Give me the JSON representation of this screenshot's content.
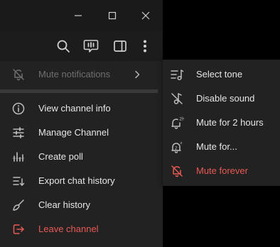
{
  "colors": {
    "text": "#e6e6e6",
    "dim_text": "#6f6f6f",
    "danger": "#e85a55",
    "icon": "#bdbdbd",
    "menu_bg": "#222222"
  },
  "titlebar": {
    "buttons": [
      {
        "name": "minimize",
        "icon": "minimize-icon"
      },
      {
        "name": "maximize",
        "icon": "maximize-icon"
      },
      {
        "name": "close",
        "icon": "close-icon"
      }
    ]
  },
  "toolbar": {
    "buttons": [
      {
        "name": "search",
        "icon": "search-icon"
      },
      {
        "name": "live-stream",
        "icon": "live-stream-icon"
      },
      {
        "name": "sidebar-toggle",
        "icon": "sidebar-toggle-icon"
      },
      {
        "name": "more",
        "icon": "more-vertical-icon"
      }
    ]
  },
  "menu": {
    "items": [
      {
        "label": "Mute notifications",
        "icon": "bell-muted-icon",
        "state": "disabled",
        "has_submenu": true
      },
      {
        "label": "View channel info",
        "icon": "info-icon"
      },
      {
        "label": "Manage Channel",
        "icon": "sliders-icon"
      },
      {
        "label": "Create poll",
        "icon": "poll-icon"
      },
      {
        "label": "Export chat history",
        "icon": "export-icon"
      },
      {
        "label": "Clear history",
        "icon": "broom-icon"
      },
      {
        "label": "Leave channel",
        "icon": "leave-icon",
        "state": "danger"
      }
    ]
  },
  "submenu": {
    "items": [
      {
        "label": "Select tone",
        "icon": "music-list-icon"
      },
      {
        "label": "Disable sound",
        "icon": "note-off-icon"
      },
      {
        "label": "Mute for 2 hours",
        "icon": "bell-2h-icon",
        "icon_text": "2h"
      },
      {
        "label": "Mute for...",
        "icon": "bell-custom-icon",
        "icon_text": "2",
        "icon_sup": "z"
      },
      {
        "label": "Mute forever",
        "icon": "bell-off-icon",
        "state": "danger"
      }
    ]
  }
}
